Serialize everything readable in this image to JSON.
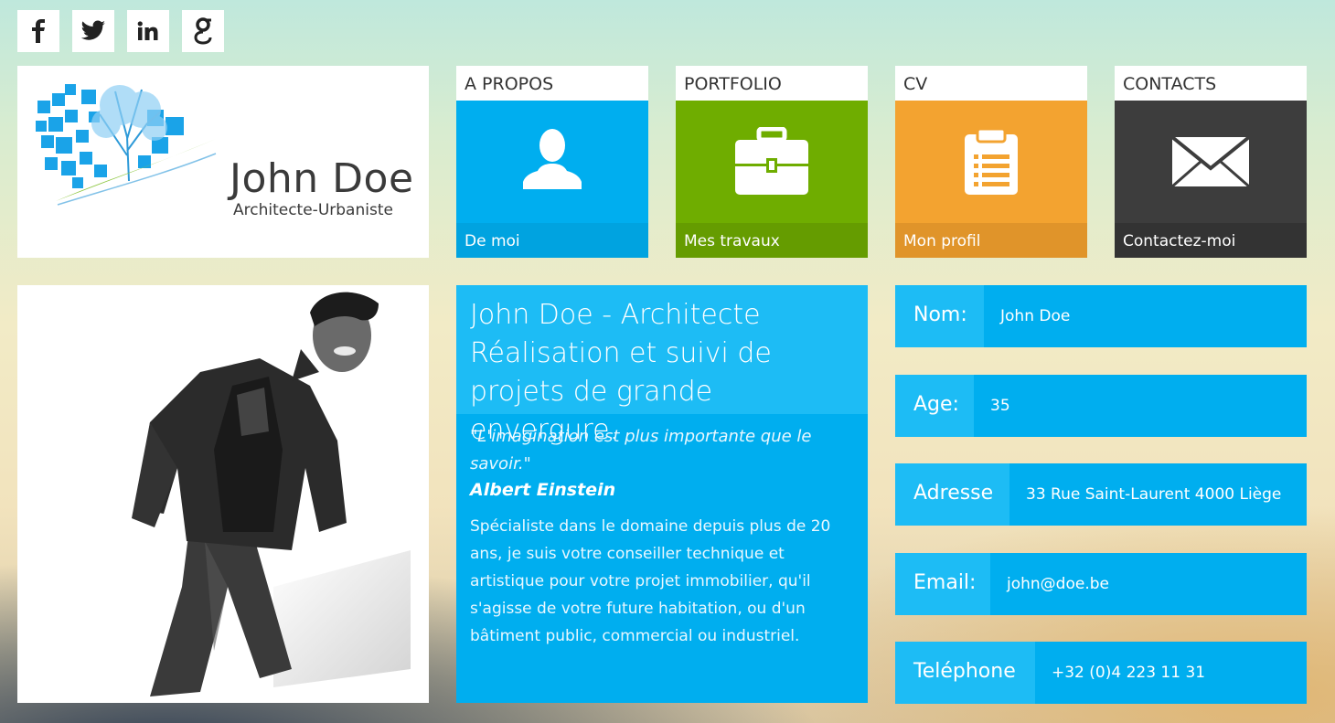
{
  "social": [
    {
      "icon": "facebook-icon",
      "glyph": "f"
    },
    {
      "icon": "twitter-icon",
      "glyph": "t"
    },
    {
      "icon": "linkedin-icon",
      "glyph": "in"
    },
    {
      "icon": "google-icon",
      "glyph": "g"
    }
  ],
  "header": {
    "name": "John Doe",
    "subtitle": "Architecte-Urbaniste"
  },
  "tiles": [
    {
      "title": "A PROPOS",
      "footer": "De moi",
      "icon": "user-icon",
      "color": "#00aeef",
      "footer_color": "#00a3e0"
    },
    {
      "title": "PORTFOLIO",
      "footer": "Mes travaux",
      "icon": "briefcase-icon",
      "color": "#6fad00",
      "footer_color": "#659c00"
    },
    {
      "title": "CV",
      "footer": "Mon profil",
      "icon": "clipboard-icon",
      "color": "#f3a330",
      "footer_color": "#e0942a"
    },
    {
      "title": "CONTACTS",
      "footer": "Contactez-moi",
      "icon": "envelope-icon",
      "color": "#3d3d3d",
      "footer_color": "#333333"
    }
  ],
  "intro": {
    "title_line1": "John Doe - Architecte",
    "title_line2": "Réalisation et suivi de projets de grande envergure.",
    "quote": "\"L'imagination est plus importante que le savoir.\"",
    "author": "Albert Einstein",
    "description": "Spécialiste dans le domaine depuis plus de 20 ans, je suis votre conseiller technique et artistique pour votre projet immobilier, qu'il s'agisse de votre future habitation, ou d'un bâtiment public, commercial ou industriel."
  },
  "info": [
    {
      "label": "Nom:",
      "value": "John Doe"
    },
    {
      "label": "Age:",
      "value": "35"
    },
    {
      "label": "Adresse",
      "value": "33 Rue Saint-Laurent 4000 Liège"
    },
    {
      "label": "Email:",
      "value": "john@doe.be"
    },
    {
      "label": "Teléphone",
      "value": "+32 (0)4 223 11 31"
    }
  ]
}
